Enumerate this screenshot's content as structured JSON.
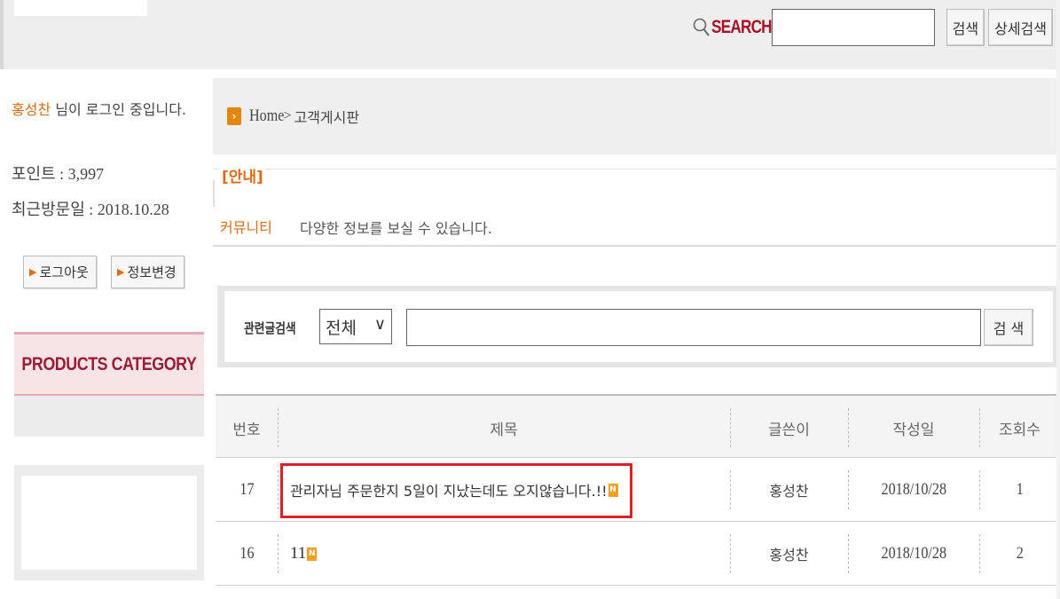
{
  "top": {
    "search_label": "SEARCH",
    "search_value": "",
    "search_button": "검색",
    "advanced_button": "상세검색"
  },
  "sidebar": {
    "user_name": "홍성찬",
    "login_suffix": " 님이 로그인 중입니다.",
    "points": "포인트 : 3,997",
    "last_visit": "최근방문일 : 2018.10.28",
    "logout_button": "로그아웃",
    "edit_info_button": "정보변경",
    "category_title": "PRODUCTS CATEGORY"
  },
  "breadcrumb": {
    "icon_name": "arrow-right-icon",
    "home": "Home",
    "separator": ">",
    "page": "고객게시판"
  },
  "notice": {
    "title": "[안내]",
    "category": "커뮤니티",
    "text": "다양한 정보를 보실 수 있습니다."
  },
  "board_search": {
    "label": "관련글검색",
    "select_value": "전체",
    "input_value": "",
    "button": "검 색"
  },
  "board": {
    "columns": [
      "번호",
      "제목",
      "글쓴이",
      "작성일",
      "조회수"
    ],
    "rows": [
      {
        "no": "17",
        "title": "관리자님 주문한지 5일이 지났는데도 오지않습니다.!!",
        "new_badge": "N",
        "writer": "홍성찬",
        "date": "2018/10/28",
        "views": "1"
      },
      {
        "no": "16",
        "title": "11",
        "new_badge": "N",
        "writer": "홍성찬",
        "date": "2018/10/28",
        "views": "2"
      }
    ]
  },
  "colors": {
    "accent_orange": "#e06a15",
    "search_brand": "#a8102a",
    "category_text": "#9a1d36",
    "highlight_border": "#d9222a",
    "new_badge": "#f0a020"
  }
}
